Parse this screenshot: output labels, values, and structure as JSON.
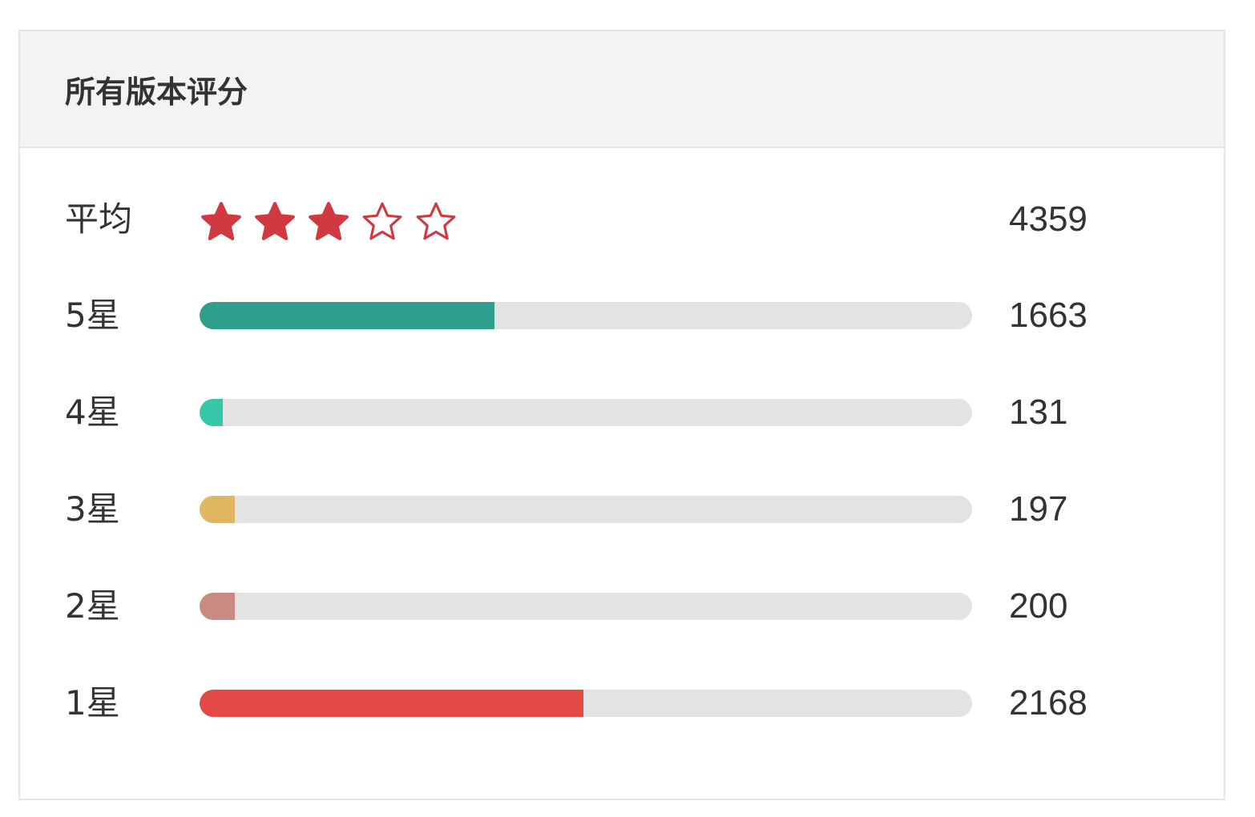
{
  "panel": {
    "title": "所有版本评分"
  },
  "average": {
    "label": "平均",
    "rating": 3,
    "max_rating": 5,
    "total_count": "4359",
    "star_color": "#d0393f"
  },
  "distribution": [
    {
      "label": "5星",
      "count": "1663",
      "fraction": 0.3815,
      "color": "#2f9e8f"
    },
    {
      "label": "4星",
      "count": "131",
      "fraction": 0.0301,
      "color": "#36c7a9"
    },
    {
      "label": "3星",
      "count": "197",
      "fraction": 0.0452,
      "color": "#e0b661"
    },
    {
      "label": "2星",
      "count": "200",
      "fraction": 0.0459,
      "color": "#c98a83"
    },
    {
      "label": "1星",
      "count": "2168",
      "fraction": 0.4974,
      "color": "#e34a46"
    }
  ],
  "colors": {
    "track": "#e3e3e3",
    "header_bg": "#f2f3f5",
    "border": "#e3e5ea",
    "text": "#333333"
  }
}
